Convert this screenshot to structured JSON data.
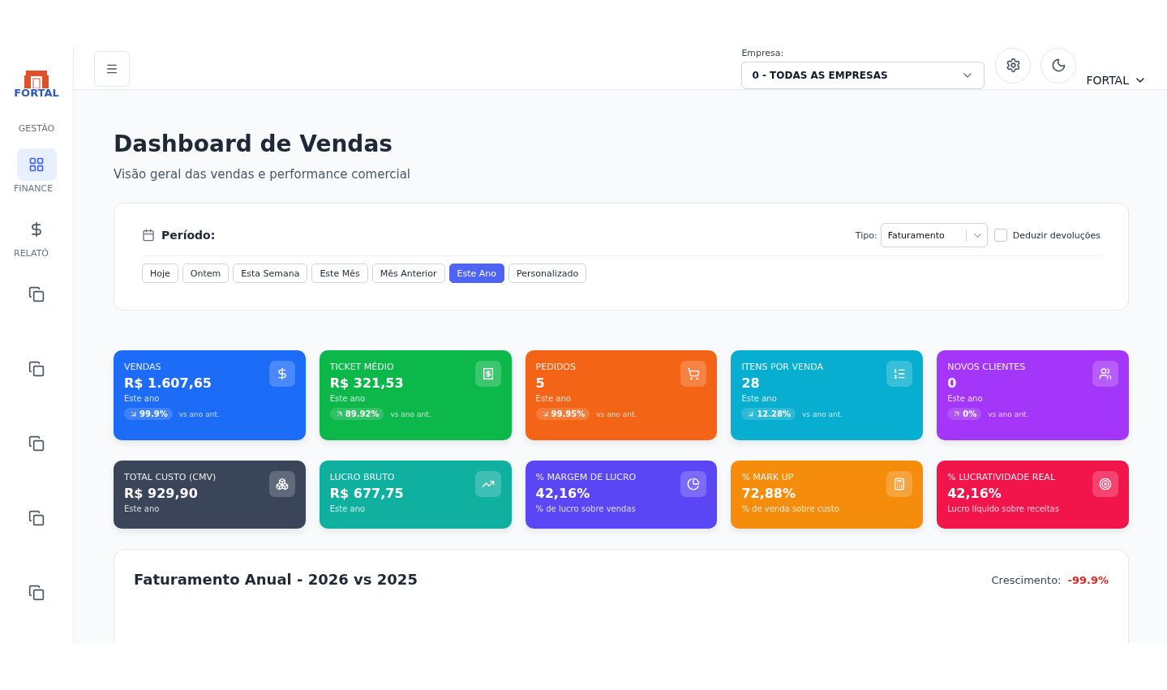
{
  "sidebar": {
    "logo": "FORTAL",
    "sections": [
      {
        "kind": "label",
        "label": "GESTÃO"
      },
      {
        "kind": "item",
        "label": "FINANCE",
        "selected": true
      },
      {
        "kind": "item",
        "label": "RELATÓ",
        "selected": false
      },
      {
        "kind": "item",
        "selected": false
      },
      {
        "kind": "item",
        "selected": false
      },
      {
        "kind": "item",
        "selected": false
      },
      {
        "kind": "item",
        "selected": false
      },
      {
        "kind": "item",
        "selected": false
      }
    ]
  },
  "header": {
    "company_label": "Empresa:",
    "company_value": "0 - TODAS AS EMPRESAS",
    "user": "FORTAL"
  },
  "page": {
    "title": "Dashboard de Vendas",
    "subtitle": "Visão geral das vendas e performance comercial"
  },
  "filters": {
    "period_label": "Período:",
    "type_label": "Tipo:",
    "type_value": "Faturamento",
    "deduct_label": "Deduzir devoluções",
    "deduct_checked": false,
    "periods": [
      {
        "label": "Hoje",
        "selected": false
      },
      {
        "label": "Ontem",
        "selected": false
      },
      {
        "label": "Esta Semana",
        "selected": false
      },
      {
        "label": "Este Mês",
        "selected": false
      },
      {
        "label": "Mês Anterior",
        "selected": false
      },
      {
        "label": "Este Ano",
        "selected": true
      },
      {
        "label": "Personalizado",
        "selected": false
      }
    ]
  },
  "cards": [
    {
      "kind": "down",
      "color": "#1d6cf8",
      "title": "VENDAS",
      "value": "R$ 1.607,65",
      "note": "Este ano",
      "trend": "99.9%",
      "trend_note": "vs ano ant."
    },
    {
      "kind": "up",
      "color": "#0cb84a",
      "title": "TICKET MÉDIO",
      "value": "R$ 321,53",
      "note": "Este ano",
      "trend": "89.92%",
      "trend_note": "vs ano ant."
    },
    {
      "kind": "down",
      "color": "#f46416",
      "title": "PEDIDOS",
      "value": "5",
      "note": "Este ano",
      "trend": "99.95%",
      "trend_note": "vs ano ant."
    },
    {
      "kind": "down",
      "color": "#08aed0",
      "title": "ITENS POR VENDA",
      "value": "28",
      "note": "Este ano",
      "trend": "12.28%",
      "trend_note": "vs ano ant."
    },
    {
      "kind": "up",
      "color": "#a336f8",
      "title": "NOVOS CLIENTES",
      "value": "0",
      "note": "Este ano",
      "trend": "0%",
      "trend_note": "vs ano ant."
    },
    {
      "kind": "plain",
      "color": "#3a4559",
      "title": "TOTAL CUSTO (CMV)",
      "value": "R$ 929,90",
      "note": "Este ano"
    },
    {
      "kind": "plain",
      "color": "#10b0a0",
      "title": "LUCRO BRUTO",
      "value": "R$ 677,75",
      "note": "Este ano"
    },
    {
      "kind": "plain",
      "color": "#5a46f4",
      "title": "% MARGEM DE LUCRO",
      "value": "42,16%",
      "note": "% de lucro sobre vendas"
    },
    {
      "kind": "plain",
      "color": "#f58c0c",
      "title": "% MARK UP",
      "value": "72,88%",
      "note": "% de venda sobre custo"
    },
    {
      "kind": "plain",
      "color": "#f2154c",
      "title": "% LUCRATIVIDADE REAL",
      "value": "42,16%",
      "note": "Lucro líquido sobre receitas"
    }
  ],
  "chart_card": {
    "title": "Faturamento Anual - 2026 vs 2025",
    "growth_label": "Crescimento:",
    "growth_value": "-99.9%"
  }
}
